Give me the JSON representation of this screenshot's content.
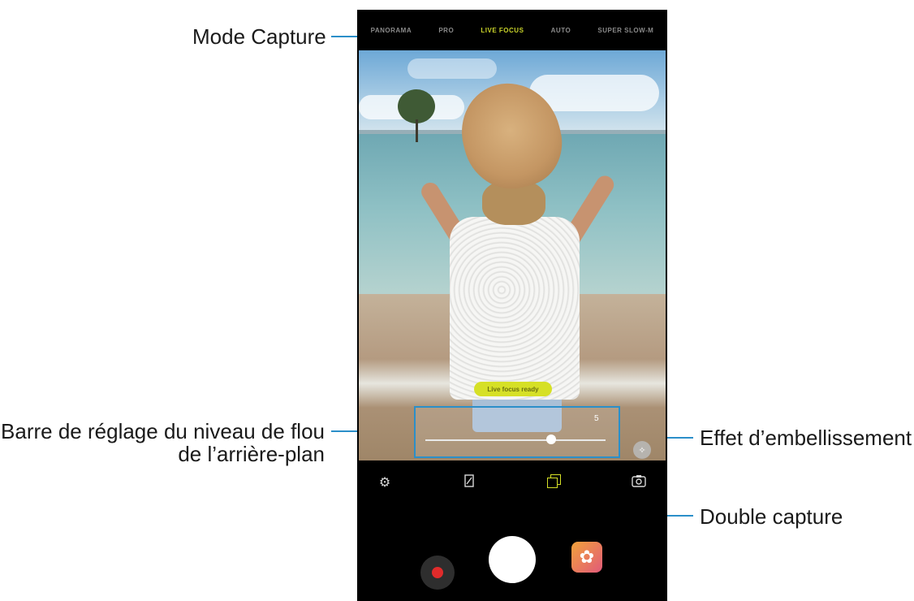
{
  "callouts": {
    "mode_capture": "Mode Capture",
    "blur_bar_line1": "Barre de réglage du niveau de flou",
    "blur_bar_line2": "de l’arrière-plan",
    "beauty_effect": "Effet d’embellissement",
    "dual_capture": "Double capture"
  },
  "camera": {
    "modes": [
      "PANORAMA",
      "PRO",
      "LIVE FOCUS",
      "AUTO",
      "SUPER SLOW-M"
    ],
    "active_mode": "LIVE FOCUS",
    "live_focus_status": "Live focus ready",
    "blur_level": "5",
    "blur_level_fraction": 0.7,
    "icons": {
      "settings": "gear-icon",
      "aspect_ratio": "aspect-ratio-icon",
      "dual_capture": "dual-capture-icon",
      "switch_camera": "switch-camera-icon",
      "beauty": "sparkle-icon",
      "record": "record-icon",
      "shutter": "shutter-icon",
      "gallery": "gallery-icon"
    }
  },
  "colors": {
    "accent": "#d6e026",
    "callout_line": "#2b8fc9",
    "record": "#e12b2b"
  }
}
